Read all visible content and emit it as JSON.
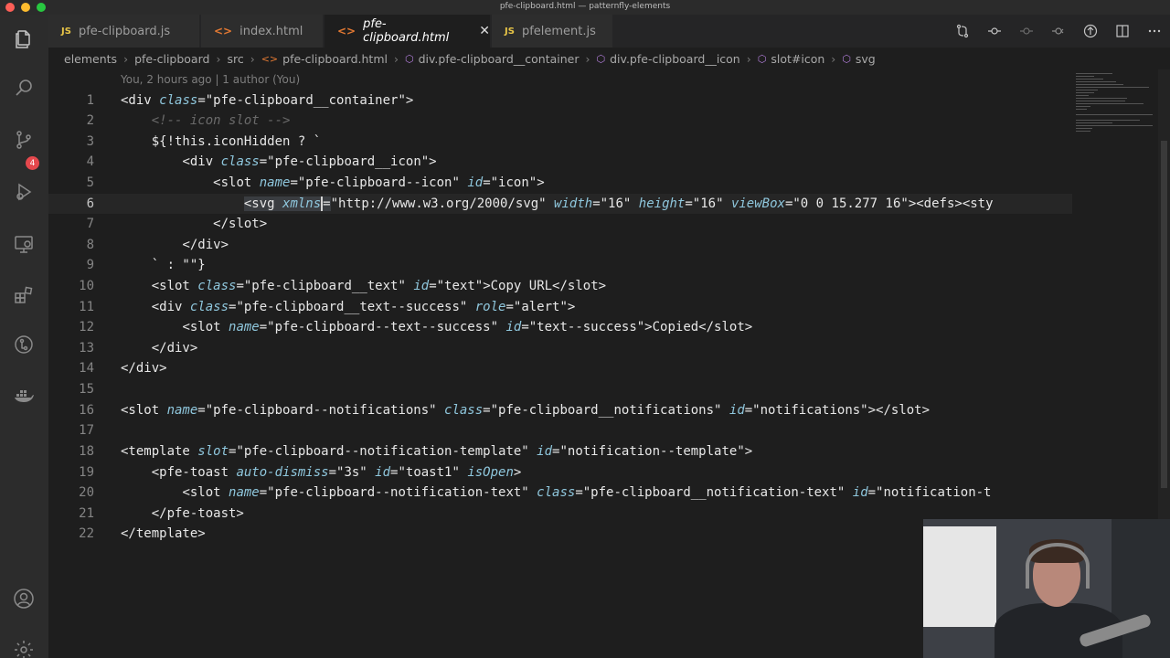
{
  "window": {
    "title": "pfe-clipboard.html — patternfly-elements"
  },
  "activity_bar": {
    "items": [
      "files-icon",
      "search-icon",
      "source-control-icon",
      "run-debug-icon",
      "remote-explorer-icon",
      "extensions-icon",
      "git-graph-icon",
      "docker-icon",
      "account-icon",
      "settings-gear-icon"
    ],
    "source_control_badge": "4"
  },
  "tabs": [
    {
      "type": "JS",
      "label": "pfe-clipboard.js"
    },
    {
      "type": "<>",
      "label": "index.html"
    },
    {
      "type": "<>",
      "label": "pfe-clipboard.html",
      "close": "✕"
    },
    {
      "type": "JS",
      "label": "pfelement.js"
    }
  ],
  "breadcrumb": [
    "elements",
    "pfe-clipboard",
    "src",
    "pfe-clipboard.html",
    "div.pfe-clipboard__container",
    "div.pfe-clipboard__icon",
    "slot#icon",
    "svg"
  ],
  "editor": {
    "blame": "You, 2 hours ago | 1 author (You)",
    "current_line": 6,
    "line_numbers": [
      "1",
      "2",
      "3",
      "4",
      "5",
      "6",
      "7",
      "8",
      "9",
      "10",
      "11",
      "12",
      "13",
      "14",
      "15",
      "16",
      "17",
      "18",
      "19",
      "20",
      "21",
      "22"
    ],
    "lines": {
      "l1": [
        "<div ",
        "class",
        "=\"pfe-clipboard__container\">"
      ],
      "l2": [
        "<!-- icon slot -->"
      ],
      "l3": [
        "${!this.iconHidden ? `"
      ],
      "l4": [
        "<div ",
        "class",
        "=\"pfe-clipboard__icon\">"
      ],
      "l5": [
        "<slot ",
        "name",
        "=\"pfe-clipboard--icon\" ",
        "id",
        "=\"icon\">"
      ],
      "l6": [
        "<svg ",
        "xmlns",
        "=",
        "\"http://www.w3.org/2000/svg\" ",
        "width",
        "=\"16\" ",
        "height",
        "=\"16\" ",
        "viewBox",
        "=\"0 0 15.277 16\"><defs><sty"
      ],
      "l7": [
        "</slot>"
      ],
      "l8": [
        "</div>"
      ],
      "l9": [
        "` : \"\"}"
      ],
      "l10": [
        "<slot ",
        "class",
        "=\"pfe-clipboard__text\" ",
        "id",
        "=\"text\">Copy URL</slot>"
      ],
      "l11": [
        "<div ",
        "class",
        "=\"pfe-clipboard__text--success\" ",
        "role",
        "=\"alert\">"
      ],
      "l12": [
        "<slot ",
        "name",
        "=\"pfe-clipboard--text--success\" ",
        "id",
        "=\"text--success\">Copied</slot>"
      ],
      "l13": [
        "</div>"
      ],
      "l14": [
        "</div>"
      ],
      "l16": [
        "<slot ",
        "name",
        "=\"pfe-clipboard--notifications\" ",
        "class",
        "=\"pfe-clipboard__notifications\" ",
        "id",
        "=\"notifications\"></slot>"
      ],
      "l18": [
        "<template ",
        "slot",
        "=\"pfe-clipboard--notification-template\" ",
        "id",
        "=\"notification--template\">"
      ],
      "l19": [
        "<pfe-toast ",
        "auto-dismiss",
        "=\"3s\" ",
        "id",
        "=\"toast1\" ",
        "isOpen",
        ">"
      ],
      "l20": [
        "<slot ",
        "name",
        "=\"pfe-clipboard--notification-text\" ",
        "class",
        "=\"pfe-clipboard__notification-text\" ",
        "id",
        "=\"notification-t"
      ],
      "l21": [
        "</pfe-toast>"
      ],
      "l22": [
        "</template>"
      ]
    }
  },
  "colors": {
    "editor_bg": "#1e1e1e",
    "activity_bar_bg": "#2c2c2c",
    "tab_active_bg": "#1e1e1e",
    "attr": "#8fc7dd",
    "badge": "#e5484d"
  }
}
